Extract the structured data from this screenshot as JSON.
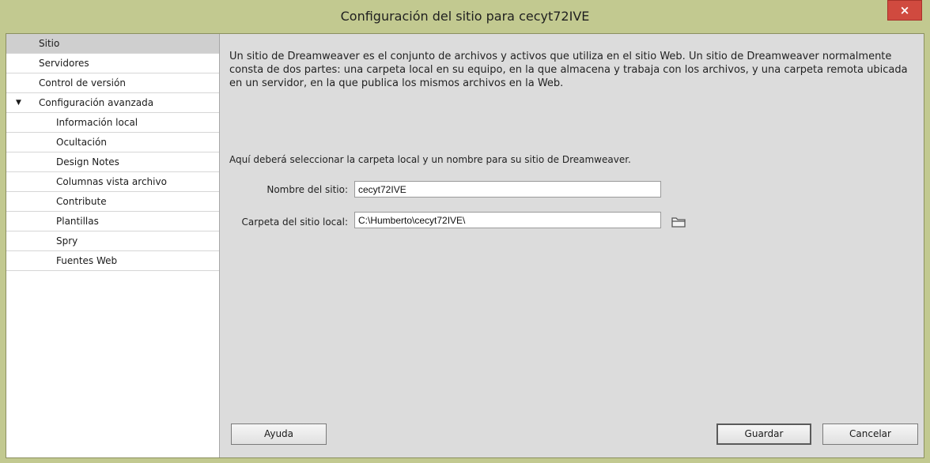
{
  "window": {
    "title": "Configuración del sitio para cecyt72IVE",
    "close_glyph": "×"
  },
  "sidebar": {
    "items": [
      {
        "label": "Sitio",
        "selected": true,
        "level": 0
      },
      {
        "label": "Servidores",
        "level": 0
      },
      {
        "label": "Control de versión",
        "level": 0
      },
      {
        "label": "Configuración avanzada",
        "level": 0,
        "expanded": true
      },
      {
        "label": "Información local",
        "level": 1
      },
      {
        "label": "Ocultación",
        "level": 1
      },
      {
        "label": "Design Notes",
        "level": 1
      },
      {
        "label": "Columnas vista archivo",
        "level": 1
      },
      {
        "label": "Contribute",
        "level": 1
      },
      {
        "label": "Plantillas",
        "level": 1
      },
      {
        "label": "Spry",
        "level": 1
      },
      {
        "label": "Fuentes Web",
        "level": 1
      }
    ],
    "expand_glyph": "▼"
  },
  "main": {
    "intro": "Un sitio de Dreamweaver es el conjunto de archivos y activos que utiliza en el sitio Web. Un sitio de Dreamweaver normalmente consta de dos partes: una carpeta local en su equipo, en la que almacena y trabaja con los archivos, y una carpeta remota ubicada en un servidor, en la que publica los mismos archivos en la Web.",
    "instruction": "Aquí deberá seleccionar la carpeta local y un nombre para su sitio de Dreamweaver.",
    "site_name_label": "Nombre del sitio:",
    "site_name_value": "cecyt72IVE",
    "local_folder_label": "Carpeta del sitio local:",
    "local_folder_value": "C:\\Humberto\\cecyt72IVE\\"
  },
  "buttons": {
    "help": "Ayuda",
    "save": "Guardar",
    "cancel": "Cancelar"
  },
  "icons": {
    "folder": "folder-icon",
    "close": "close-icon"
  },
  "colors": {
    "frame": "#c2c990",
    "close": "#d04a3f",
    "selected_item": "#cfcfcf",
    "panel": "#dcdcdc"
  }
}
